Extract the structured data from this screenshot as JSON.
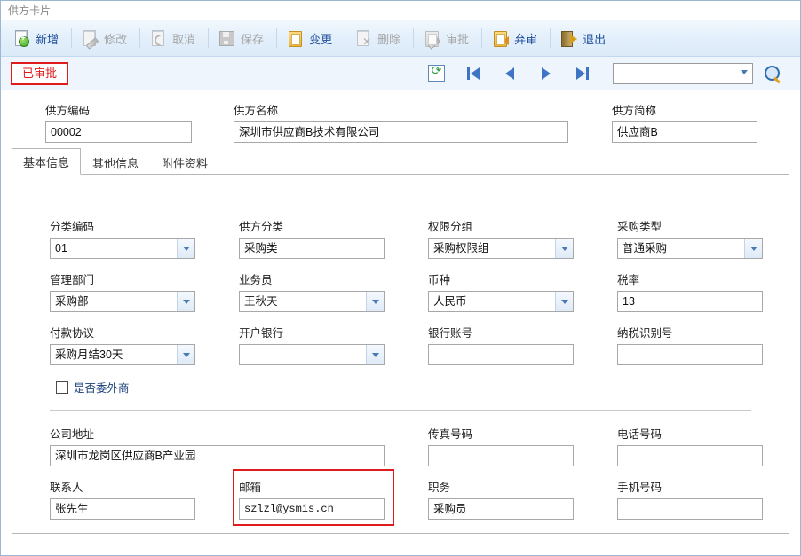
{
  "window": {
    "title": "供方卡片"
  },
  "toolbar": {
    "buttons": [
      {
        "label": "新增",
        "icon": "new-page-icon",
        "enabled": true
      },
      {
        "label": "修改",
        "icon": "edit-pencil-icon",
        "enabled": false
      },
      {
        "label": "取消",
        "icon": "undo-icon",
        "enabled": false
      },
      {
        "label": "保存",
        "icon": "save-disk-icon",
        "enabled": false
      },
      {
        "label": "变更",
        "icon": "clipboard-icon",
        "enabled": true
      },
      {
        "label": "删除",
        "icon": "delete-icon",
        "enabled": false
      },
      {
        "label": "审批",
        "icon": "approve-icon",
        "enabled": false
      },
      {
        "label": "弃审",
        "icon": "revoke-approval-icon",
        "enabled": true
      },
      {
        "label": "退出",
        "icon": "exit-door-icon",
        "enabled": true
      }
    ]
  },
  "statusbar": {
    "badge": "已审批",
    "nav": {
      "refresh": "refresh-icon",
      "first": "first-record-icon",
      "prev": "previous-record-icon",
      "next": "next-record-icon",
      "last": "last-record-icon",
      "combo_value": "",
      "combo_placeholder": "",
      "search": "search-icon"
    }
  },
  "header": {
    "fields": [
      {
        "label": "供方编码",
        "value": "00002"
      },
      {
        "label": "供方名称",
        "value": "深圳市供应商B技术有限公司"
      },
      {
        "label": "供方简称",
        "value": "供应商B"
      }
    ]
  },
  "tabs": [
    {
      "label": "基本信息",
      "active": true
    },
    {
      "label": "其他信息",
      "active": false
    },
    {
      "label": "附件资料",
      "active": false
    }
  ],
  "form": {
    "row1": [
      {
        "label": "分类编码",
        "value": "01",
        "type": "combo"
      },
      {
        "label": "供方分类",
        "value": "采购类",
        "type": "text"
      },
      {
        "label": "权限分组",
        "value": "采购权限组",
        "type": "combo"
      },
      {
        "label": "采购类型",
        "value": "普通采购",
        "type": "combo"
      }
    ],
    "row2": [
      {
        "label": "管理部门",
        "value": "采购部",
        "type": "combo"
      },
      {
        "label": "业务员",
        "value": "王秋天",
        "type": "combo"
      },
      {
        "label": "币种",
        "value": "人民币",
        "type": "combo"
      },
      {
        "label": "税率",
        "value": "13",
        "type": "text"
      }
    ],
    "row3": [
      {
        "label": "付款协议",
        "value": "采购月结30天",
        "type": "combo"
      },
      {
        "label": "开户银行",
        "value": "",
        "type": "combo"
      },
      {
        "label": "银行账号",
        "value": "",
        "type": "text"
      },
      {
        "label": "纳税识别号",
        "value": "",
        "type": "text"
      }
    ],
    "checkbox": {
      "label": "是否委外商",
      "checked": false
    },
    "row4": [
      {
        "label": "公司地址",
        "value": "深圳市龙岗区供应商B产业园",
        "type": "text"
      },
      {
        "label": "传真号码",
        "value": "",
        "type": "text"
      },
      {
        "label": "电话号码",
        "value": "",
        "type": "text"
      }
    ],
    "row5": [
      {
        "label": "联系人",
        "value": "张先生",
        "type": "text"
      },
      {
        "label": "邮箱",
        "value": "szlzl@ysmis.cn",
        "type": "text",
        "highlighted": true
      },
      {
        "label": "职务",
        "value": "采购员",
        "type": "text"
      },
      {
        "label": "手机号码",
        "value": "",
        "type": "text"
      }
    ]
  },
  "colors": {
    "accent": "#1f4e9c",
    "alert": "#e01b1b",
    "toolbar_bg": "#e3effb",
    "panel_bg": "#ffffff"
  }
}
